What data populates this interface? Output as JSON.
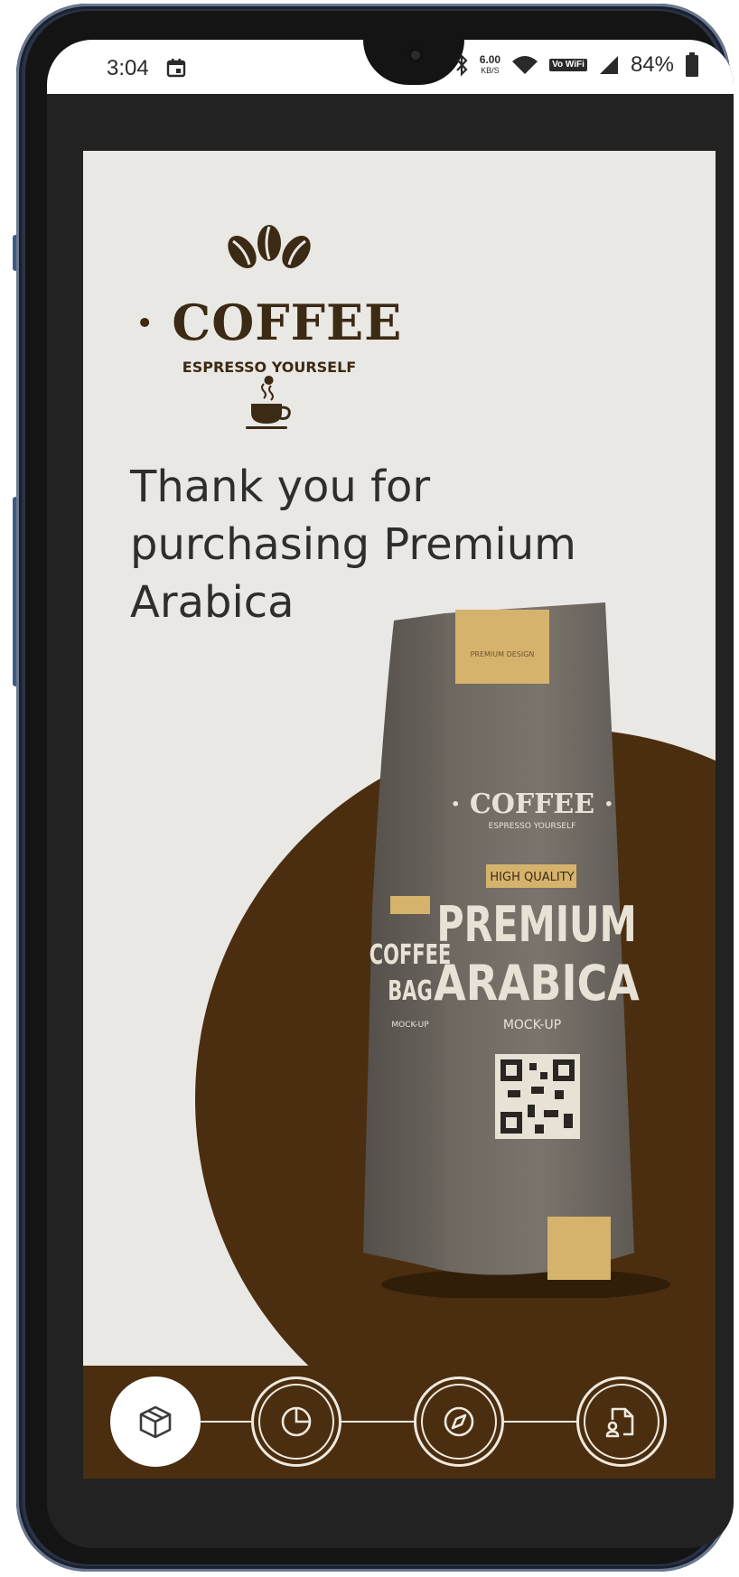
{
  "status_bar": {
    "time": "3:04",
    "net_speed_value": "6.00",
    "net_speed_unit": "KB/S",
    "volte_label": "Vo WiFi",
    "battery": "84%",
    "icons": [
      "calendar-icon",
      "bluetooth-icon",
      "wifi-icon",
      "signal-icon",
      "battery-icon"
    ]
  },
  "logo": {
    "title": "· COFFEE ·",
    "tagline": "ESPRESSO YOURSELF"
  },
  "message": "Thank you for purchasing Premium Arabica",
  "product_image": {
    "lettering": [
      "PREMIUM DESIGN",
      "COFFEE",
      "ESPRESSO YOURSELF",
      "HIGH QUALITY",
      "PREMIUM",
      "ARABICA",
      "MOCK-UP",
      "COFFEE",
      "BAG",
      "MOCK-UP"
    ]
  },
  "steps": [
    {
      "name": "box-icon",
      "active": true
    },
    {
      "name": "pie-chart-icon",
      "active": false
    },
    {
      "name": "compass-icon",
      "active": false
    },
    {
      "name": "document-person-icon",
      "active": false
    }
  ],
  "colors": {
    "brand_brown": "#4b2e0f",
    "background": "#eae8e4",
    "text_dark": "#2e2e2e"
  }
}
